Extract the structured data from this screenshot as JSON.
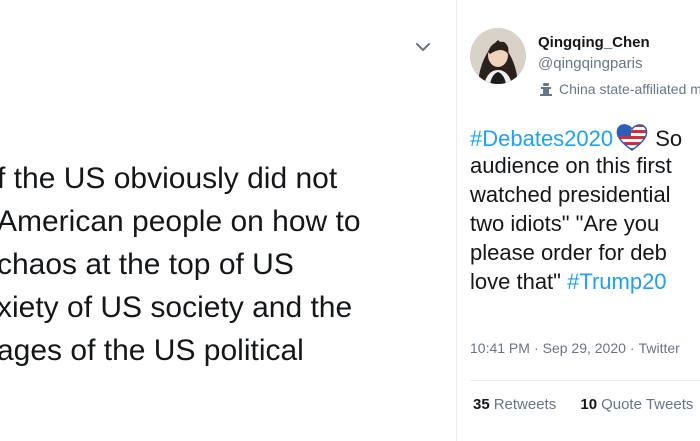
{
  "left_tweet": {
    "body_lines": [
      "f the US obviously did not",
      "American people on how to",
      "chaos at the top of US",
      "xiety of US society and the",
      "ages of the US political"
    ]
  },
  "right_tweet": {
    "author": {
      "display_name": "Qingqing_Chen",
      "handle": "@qingqingparis",
      "affiliation_label": "China state-affiliated media"
    },
    "body": {
      "line1_hashtag": "#Debates2020",
      "line1_after": " So",
      "line2": "audience on this first",
      "line3": "watched presidential",
      "line4": "two idiots\" \"Are you",
      "line5": "please order for deb",
      "line6_text": "love that\" ",
      "line6_hashtag": "#Trump20"
    },
    "meta": {
      "time": "10:41 PM",
      "date": "Sep 29, 2020",
      "source": "Twitter"
    },
    "stats": {
      "retweets_count": "35",
      "retweets_label": "Retweets",
      "quotes_count": "10",
      "quotes_label": "Quote Tweets"
    }
  },
  "icons": {
    "chevron": "chevron-down-icon",
    "affiliation": "podium-icon",
    "flag": "us-flag-heart-emoji"
  },
  "colors": {
    "link": "#1da1f2",
    "secondary": "#657786",
    "text": "#14171a",
    "divider": "#e6ecf0"
  }
}
